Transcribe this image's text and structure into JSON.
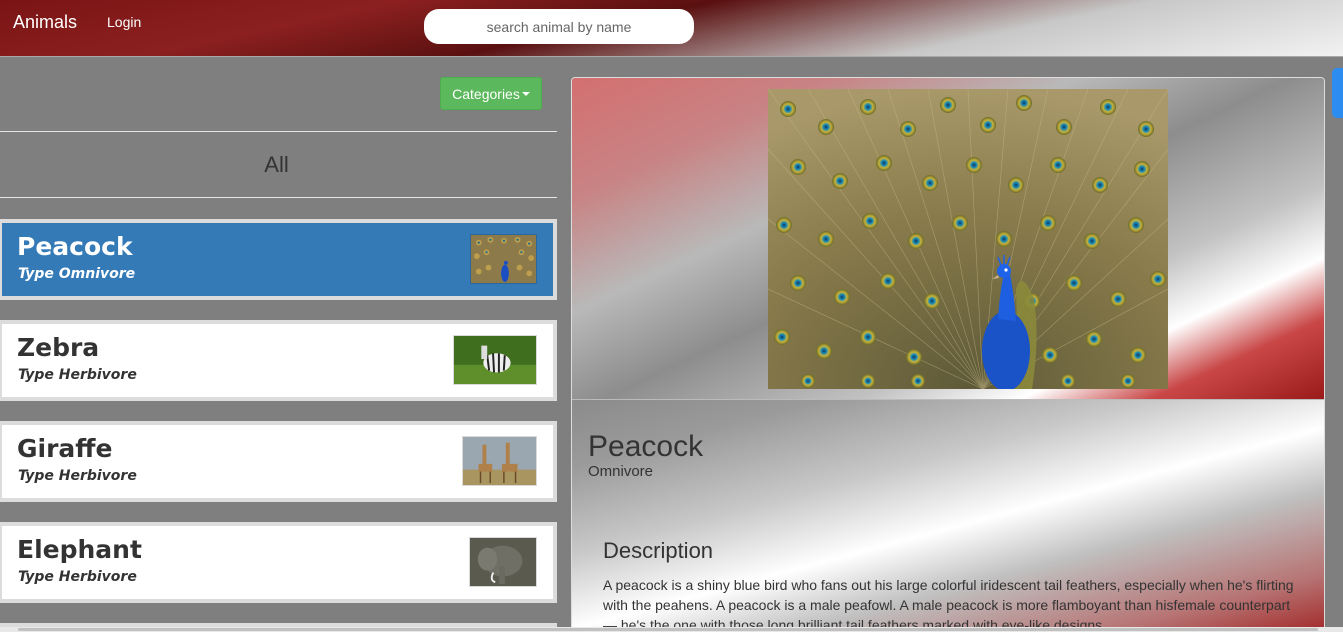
{
  "navbar": {
    "brand": "Animals",
    "login": "Login",
    "search_placeholder": "search animal by name"
  },
  "sidebar": {
    "categories_button": "Categories",
    "heading": "All",
    "animals": [
      {
        "name": "Peacock",
        "type": "Type Omnivore",
        "active": true
      },
      {
        "name": "Zebra",
        "type": "Type Herbivore",
        "active": false
      },
      {
        "name": "Giraffe",
        "type": "Type Herbivore",
        "active": false
      },
      {
        "name": "Elephant",
        "type": "Type Herbivore",
        "active": false
      }
    ]
  },
  "detail": {
    "name": "Peacock",
    "type": "Omnivore",
    "description_title": "Description",
    "description": "A peacock is a shiny blue bird who fans out his large colorful iridescent tail feathers, especially when he's flirting with the peahens. A peacock is a male peafowl. A male peacock is more flamboyant than hisfemale counterpart — he's the one with those long brilliant tail feathers marked with eye-like designs."
  },
  "colors": {
    "active_card": "#337ab7",
    "categories_button": "#5cb85c",
    "scrollbar_thumb": "#2d8cf0"
  }
}
